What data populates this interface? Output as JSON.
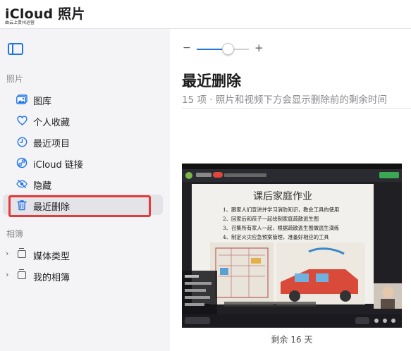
{
  "header": {
    "app_title": "iCloud 照片",
    "app_subtitle": "由云上贵州运营"
  },
  "sidebar": {
    "section_photos": "照片",
    "section_albums": "相簿",
    "items": [
      {
        "label": "图库",
        "icon": "photo-library-icon"
      },
      {
        "label": "个人收藏",
        "icon": "heart-icon"
      },
      {
        "label": "最近项目",
        "icon": "clock-icon"
      },
      {
        "label": "iCloud 链接",
        "icon": "link-icon"
      },
      {
        "label": "隐藏",
        "icon": "eye-slash-icon"
      },
      {
        "label": "最近删除",
        "icon": "trash-icon",
        "selected": true
      }
    ],
    "albums": [
      {
        "label": "媒体类型",
        "icon": "album-stack-icon"
      },
      {
        "label": "我的相簿",
        "icon": "album-stack-icon"
      }
    ]
  },
  "toolbar": {
    "zoom_minus": "−",
    "zoom_plus": "+",
    "zoom_level": 0.6
  },
  "main": {
    "title": "最近删除",
    "subtitle": "15 项 · 照片和视频下方会显示删除前的剩余时间",
    "photo_caption": "剩余 16 天"
  },
  "photo": {
    "slide_title": "课后家庭作业",
    "slide_lines": [
      "1、跟家人们宣讲并学习消防知识，教会工具的使用",
      "2、回家后和孩子一起绘制家庭疏散逃生图",
      "3、召集所有家人一起，根据疏散逃生图做逃生演练",
      "4、制定火灾应急预案管理，准备好相应的工具"
    ]
  },
  "colors": {
    "accent": "#1f74e8",
    "highlight": "#e5393a",
    "selected_bg": "#e4e4e8"
  }
}
